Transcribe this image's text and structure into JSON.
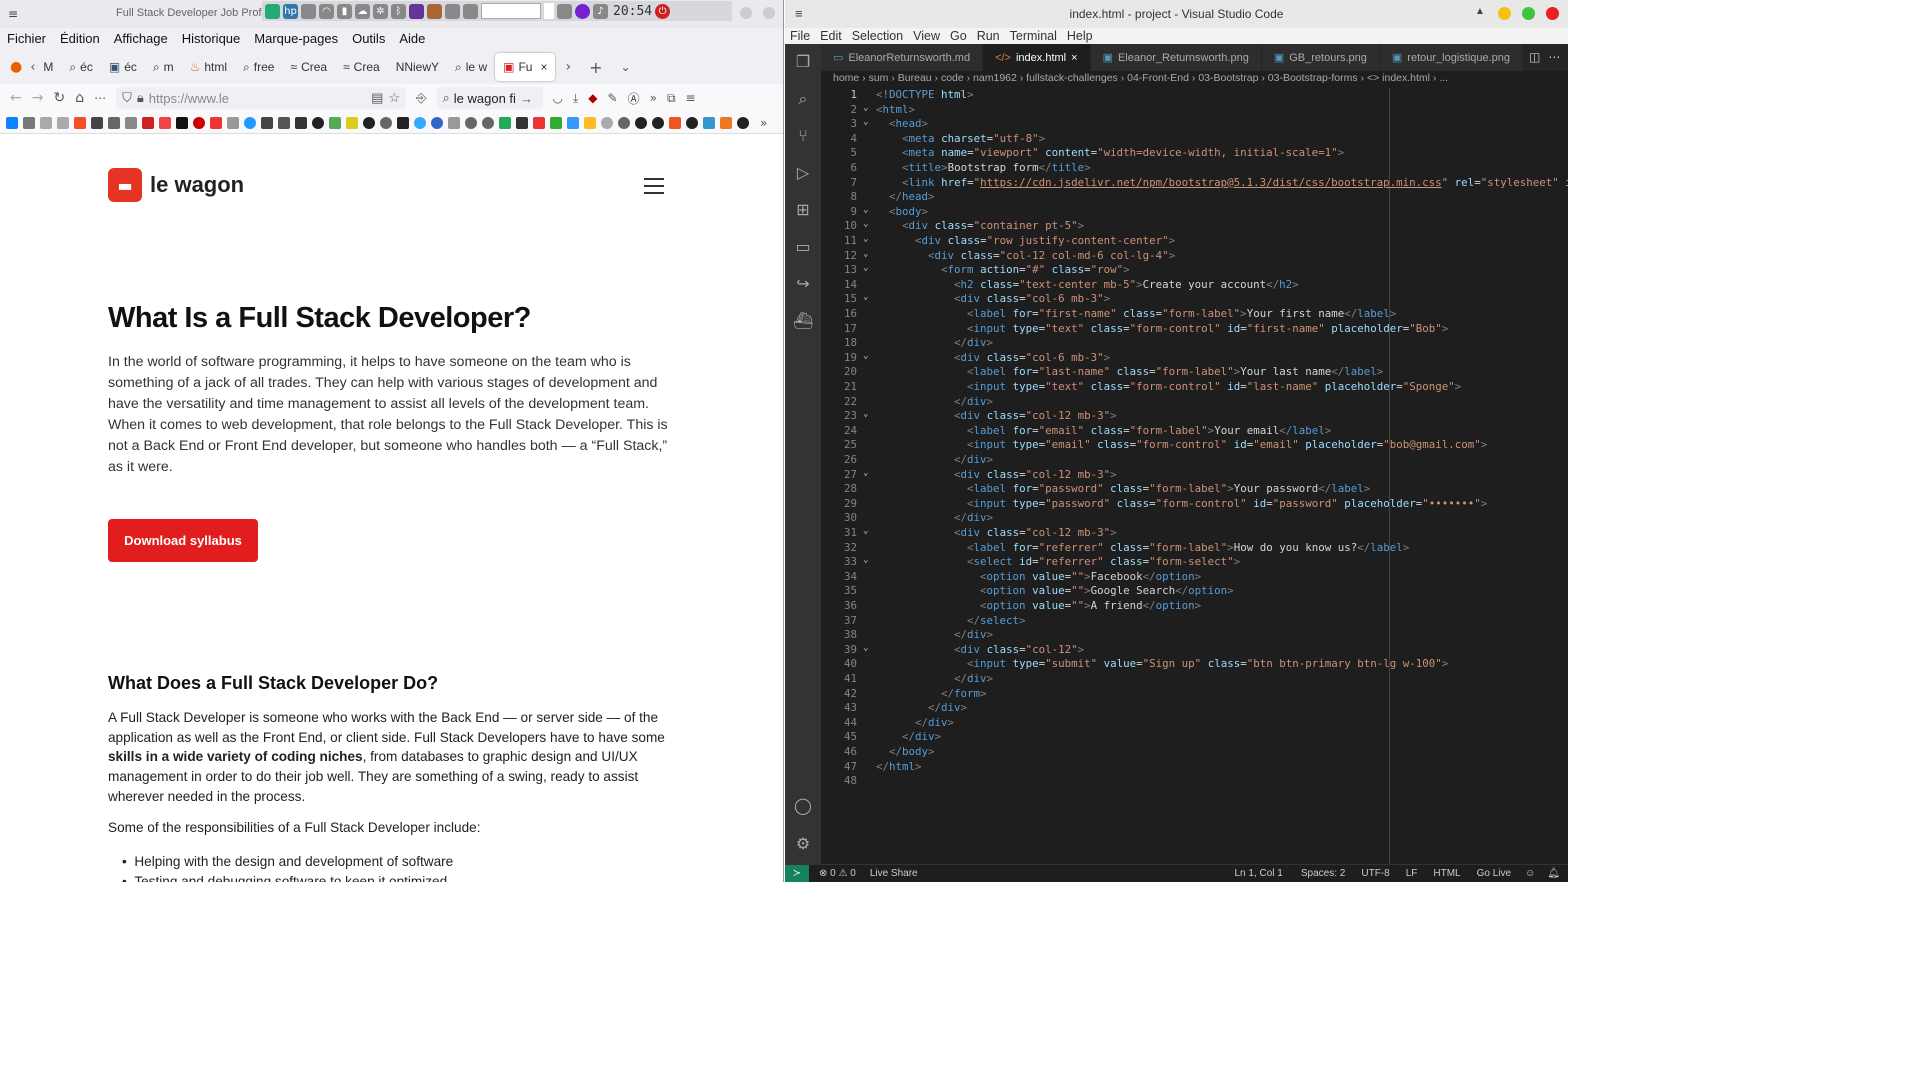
{
  "firefox": {
    "title": "Full Stack Developer Job Profile",
    "clock": "20:54",
    "menu": [
      "Fichier",
      "Édition",
      "Affichage",
      "Historique",
      "Marque-pages",
      "Outils",
      "Aide"
    ],
    "tabs": [
      {
        "label": "M"
      },
      {
        "label": "éc"
      },
      {
        "label": "éc"
      },
      {
        "label": "m"
      },
      {
        "label": "html"
      },
      {
        "label": "free"
      },
      {
        "label": "Crea"
      },
      {
        "label": "Crea"
      },
      {
        "label": "NNiewY"
      },
      {
        "label": "le w"
      },
      {
        "label": "Fu",
        "active": true
      }
    ],
    "url": "https://www.le",
    "search": "le wagon fi",
    "site": {
      "brand": "le wagon",
      "h1": "What Is a Full Stack Developer?",
      "p1": "In the world of software programming, it helps to have someone on the team who is something of a jack of all trades. They can help with various stages of development and have the versatility and time management to assist all levels of the development team. When it comes to web development, that role belongs to the Full Stack Developer. This is not a Back End or Front End developer, but someone who handles both — a “Full Stack,” as it were.",
      "download": "Download syllabus",
      "h2": "What Does a Full Stack Developer Do?",
      "p2a": "A Full Stack Developer is someone who works with the Back End — or server side — of the application as well as the Front End, or client side. Full Stack Developers have to have some ",
      "p2b": "skills in a wide variety of coding niches",
      "p2c": ", from databases to graphic design and UI/UX management in order to do their job well. They are something of a swing, ready to assist wherever needed in the process.",
      "p3": "Some of the responsibilities of a Full Stack Developer include:",
      "li1": "Helping with the design and development of software",
      "li2": "Testing and debugging software to keep it optimized"
    }
  },
  "vscode": {
    "title": "index.html - project - Visual Studio Code",
    "menu": [
      "File",
      "Edit",
      "Selection",
      "View",
      "Go",
      "Run",
      "Terminal",
      "Help"
    ],
    "tabs": [
      {
        "label": "EleanorReturnsworth.md",
        "active": false
      },
      {
        "label": "index.html",
        "active": true
      },
      {
        "label": "Eleanor_Returnsworth.png",
        "active": false
      },
      {
        "label": "GB_retours.png",
        "active": false
      },
      {
        "label": "retour_logistique.png",
        "active": false
      }
    ],
    "breadcrumb": "home › sum › Bureau › code › nam1962 › fullstack-challenges › 04-Front-End › 03-Bootstrap › 03-Bootstrap-forms › <> index.html › ...",
    "status": {
      "problems": "⊗ 0 ⚠ 0",
      "liveshare": "Live Share",
      "position": "Ln 1, Col 1",
      "spaces": "Spaces: 2",
      "encoding": "UTF-8",
      "eol": "LF",
      "lang": "HTML",
      "golive": "Go Live"
    }
  }
}
